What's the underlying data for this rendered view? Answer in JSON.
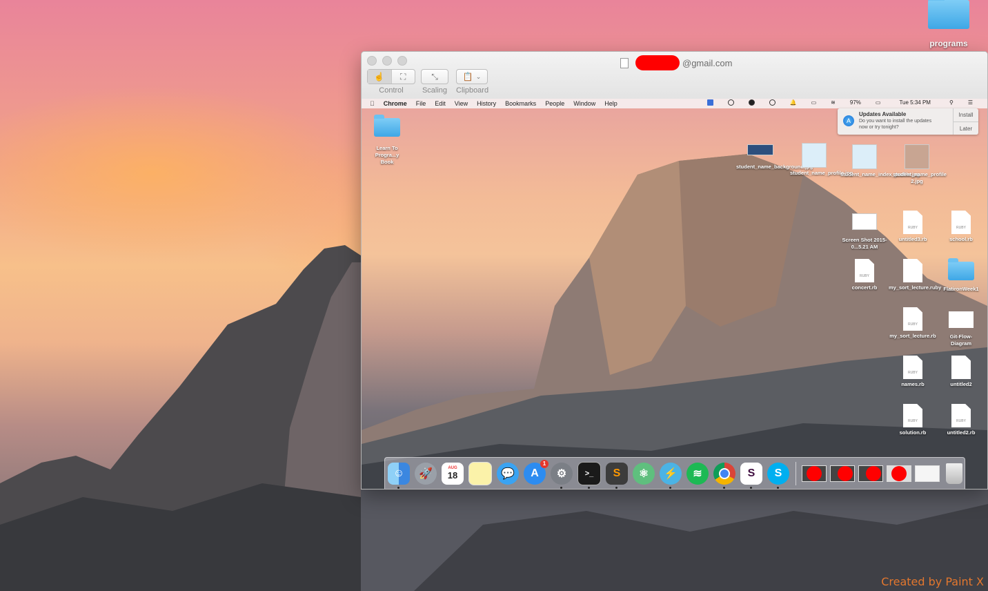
{
  "desktop": {
    "programs_folder_label": "programs",
    "watermark": "Created by Paint X"
  },
  "window": {
    "title_suffix": "@gmail.com",
    "toolbar": {
      "control_label": "Control",
      "scaling_label": "Scaling",
      "clipboard_label": "Clipboard"
    }
  },
  "remote": {
    "menu": {
      "app_name": "Chrome",
      "items": [
        "File",
        "Edit",
        "View",
        "History",
        "Bookmarks",
        "People",
        "Window",
        "Help"
      ],
      "battery": "97%",
      "clock": "Tue 5:34 PM"
    },
    "notification": {
      "title": "Updates Available",
      "body": "Do you want to install the updates now or try tonight?",
      "install_label": "Install",
      "later_label": "Later"
    },
    "icons": {
      "learn_book": "Learn To Progra...y Book",
      "background": "student_name_background.jpg",
      "profile": "student_name_profile.jpg",
      "index_profile": "student_name_index_profile.jpg",
      "profile2": "student_name_profile 2.jpg",
      "screenshot": "Screen Shot 2015-0...5.21 AM",
      "untitled3": "untitled3.rb",
      "school": "school.rb",
      "concert": "concert.rb",
      "my_sort_ruby": "my_sort_lecture.ruby",
      "flatiron": "FlatironWeek1",
      "my_sort_rb": "my_sort_lecture.rb",
      "git_flow": "Git-Flow-Diagram",
      "names": "names.rb",
      "untitled2": "untitled2",
      "solution": "solution.rb",
      "untitled2rb": "untitled2.rb",
      "ruby_tag": "RUBY"
    },
    "dock": {
      "calendar_month": "AUG",
      "calendar_day": "18",
      "appstore_badge": "1"
    }
  }
}
